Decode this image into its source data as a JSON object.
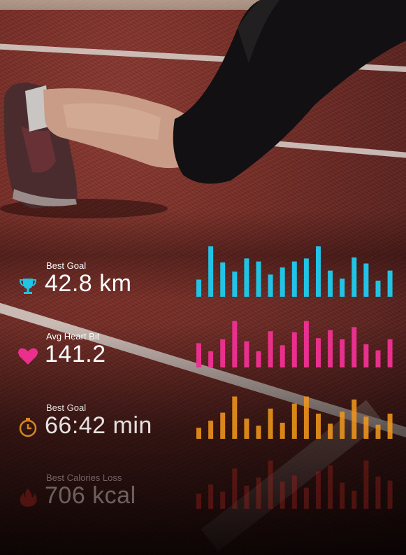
{
  "colors": {
    "distance": "#21c4e4",
    "heart": "#e8308c",
    "time": "#f0961c",
    "calories": "#b0261c"
  },
  "stats": [
    {
      "label": "Best Goal",
      "value": "42.8 km",
      "icon": "trophy-icon",
      "color": "#21c4e4",
      "opacity": 1,
      "bars": [
        0.34,
        1.0,
        0.68,
        0.5,
        0.76,
        0.7,
        0.44,
        0.58,
        0.7,
        0.76,
        1.0,
        0.52,
        0.36,
        0.78,
        0.66,
        0.32,
        0.52
      ]
    },
    {
      "label": "Avg Heart Bit",
      "value": "141.2",
      "icon": "heart-icon",
      "color": "#e8308c",
      "opacity": 1,
      "bars": [
        0.48,
        0.32,
        0.56,
        0.92,
        0.52,
        0.32,
        0.72,
        0.44,
        0.7,
        0.92,
        0.58,
        0.74,
        0.56,
        0.8,
        0.46,
        0.34,
        0.56
      ]
    },
    {
      "label": "Best Goal",
      "value": "66:42 min",
      "icon": "stopwatch-icon",
      "color": "#f0961c",
      "opacity": 0.88,
      "bars": [
        0.22,
        0.36,
        0.52,
        0.84,
        0.4,
        0.26,
        0.6,
        0.32,
        0.7,
        0.84,
        0.5,
        0.3,
        0.54,
        0.78,
        0.44,
        0.28,
        0.5
      ]
    },
    {
      "label": "Best Calories Loss",
      "value": "706 kcal",
      "icon": "flame-icon",
      "color": "#b0261c",
      "opacity": 0.35,
      "bars": [
        0.3,
        0.48,
        0.34,
        0.8,
        0.46,
        0.62,
        0.96,
        0.54,
        0.66,
        0.42,
        0.74,
        0.86,
        0.52,
        0.36,
        0.96,
        0.64,
        0.56
      ]
    }
  ]
}
